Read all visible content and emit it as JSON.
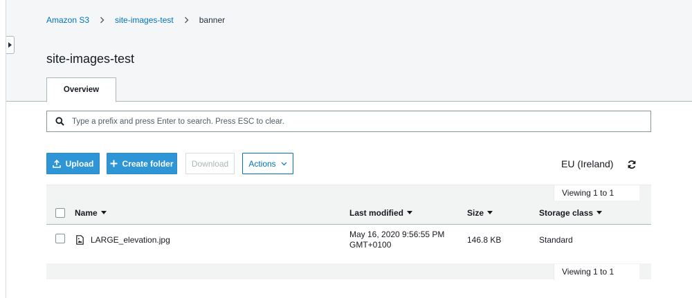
{
  "breadcrumb": {
    "items": [
      {
        "label": "Amazon S3"
      },
      {
        "label": "site-images-test"
      },
      {
        "label": "banner"
      }
    ]
  },
  "page": {
    "title": "site-images-test",
    "tab_label": "Overview"
  },
  "search": {
    "placeholder": "Type a prefix and press Enter to search. Press ESC to clear.",
    "value": ""
  },
  "toolbar": {
    "upload_label": "Upload",
    "create_folder_label": "Create folder",
    "download_label": "Download",
    "actions_label": "Actions"
  },
  "region": "EU (Ireland)",
  "pager": {
    "top_text": "Viewing 1 to 1",
    "bottom_text": "Viewing 1 to 1"
  },
  "table": {
    "columns": {
      "name": "Name",
      "last_modified": "Last modified",
      "size": "Size",
      "storage_class": "Storage class"
    },
    "rows": [
      {
        "name": "LARGE_elevation.jpg",
        "last_modified_line1": "May 16, 2020 9:56:55 PM",
        "last_modified_line2": "GMT+0100",
        "size": "146.8 KB",
        "storage_class": "Standard"
      }
    ]
  },
  "colors": {
    "accent": "#0073bb",
    "primary_button": "#2e96d6",
    "header_background": "#f4f6f8"
  },
  "icons": [
    "chevron-right-icon",
    "search-icon",
    "upload-icon",
    "plus-icon",
    "chevron-down-icon",
    "refresh-icon",
    "image-file-icon",
    "sidebar-expand-icon"
  ]
}
